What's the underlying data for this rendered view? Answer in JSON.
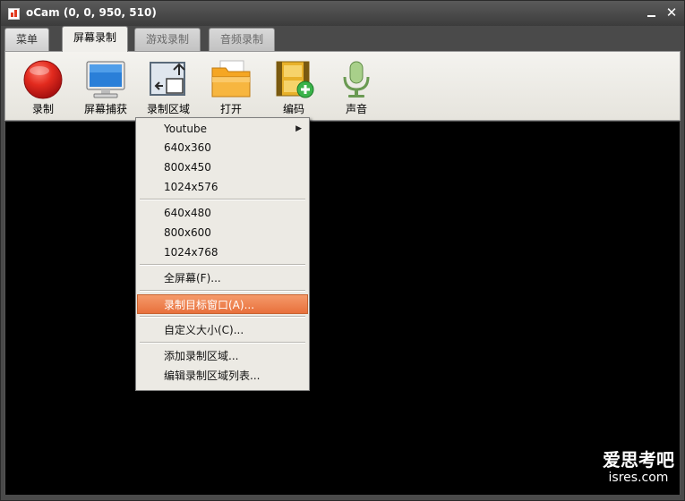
{
  "window": {
    "title": "oCam (0, 0, 950, 510)"
  },
  "tabs": [
    {
      "label": "菜单",
      "state": "normal"
    },
    {
      "label": "屏幕录制",
      "state": "active"
    },
    {
      "label": "游戏录制",
      "state": "inactive"
    },
    {
      "label": "音频录制",
      "state": "inactive"
    }
  ],
  "toolbar": [
    {
      "label": "录制",
      "icon": "record-icon"
    },
    {
      "label": "屏幕捕获",
      "icon": "monitor-icon"
    },
    {
      "label": "录制区域",
      "icon": "region-icon"
    },
    {
      "label": "打开",
      "icon": "folder-icon"
    },
    {
      "label": "编码",
      "icon": "film-add-icon"
    },
    {
      "label": "声音",
      "icon": "microphone-icon"
    }
  ],
  "menu": {
    "items": [
      {
        "label": "Youtube",
        "has_submenu": true
      },
      {
        "label": "640x360"
      },
      {
        "label": "800x450"
      },
      {
        "label": "1024x576"
      },
      {
        "label": "640x480"
      },
      {
        "label": "800x600"
      },
      {
        "label": "1024x768"
      },
      {
        "label": "全屏幕(F)..."
      },
      {
        "label": "录制目标窗口(A)...",
        "highlighted": true
      },
      {
        "label": "自定义大小(C)..."
      },
      {
        "label": "添加录制区域..."
      },
      {
        "label": "编辑录制区域列表..."
      }
    ]
  },
  "watermark": {
    "line1": "爱思考吧",
    "line2": "isres.com"
  },
  "colors": {
    "highlight": "#e8703c",
    "titlebar": "#3c3c3c",
    "record_red": "#d61e1e"
  }
}
